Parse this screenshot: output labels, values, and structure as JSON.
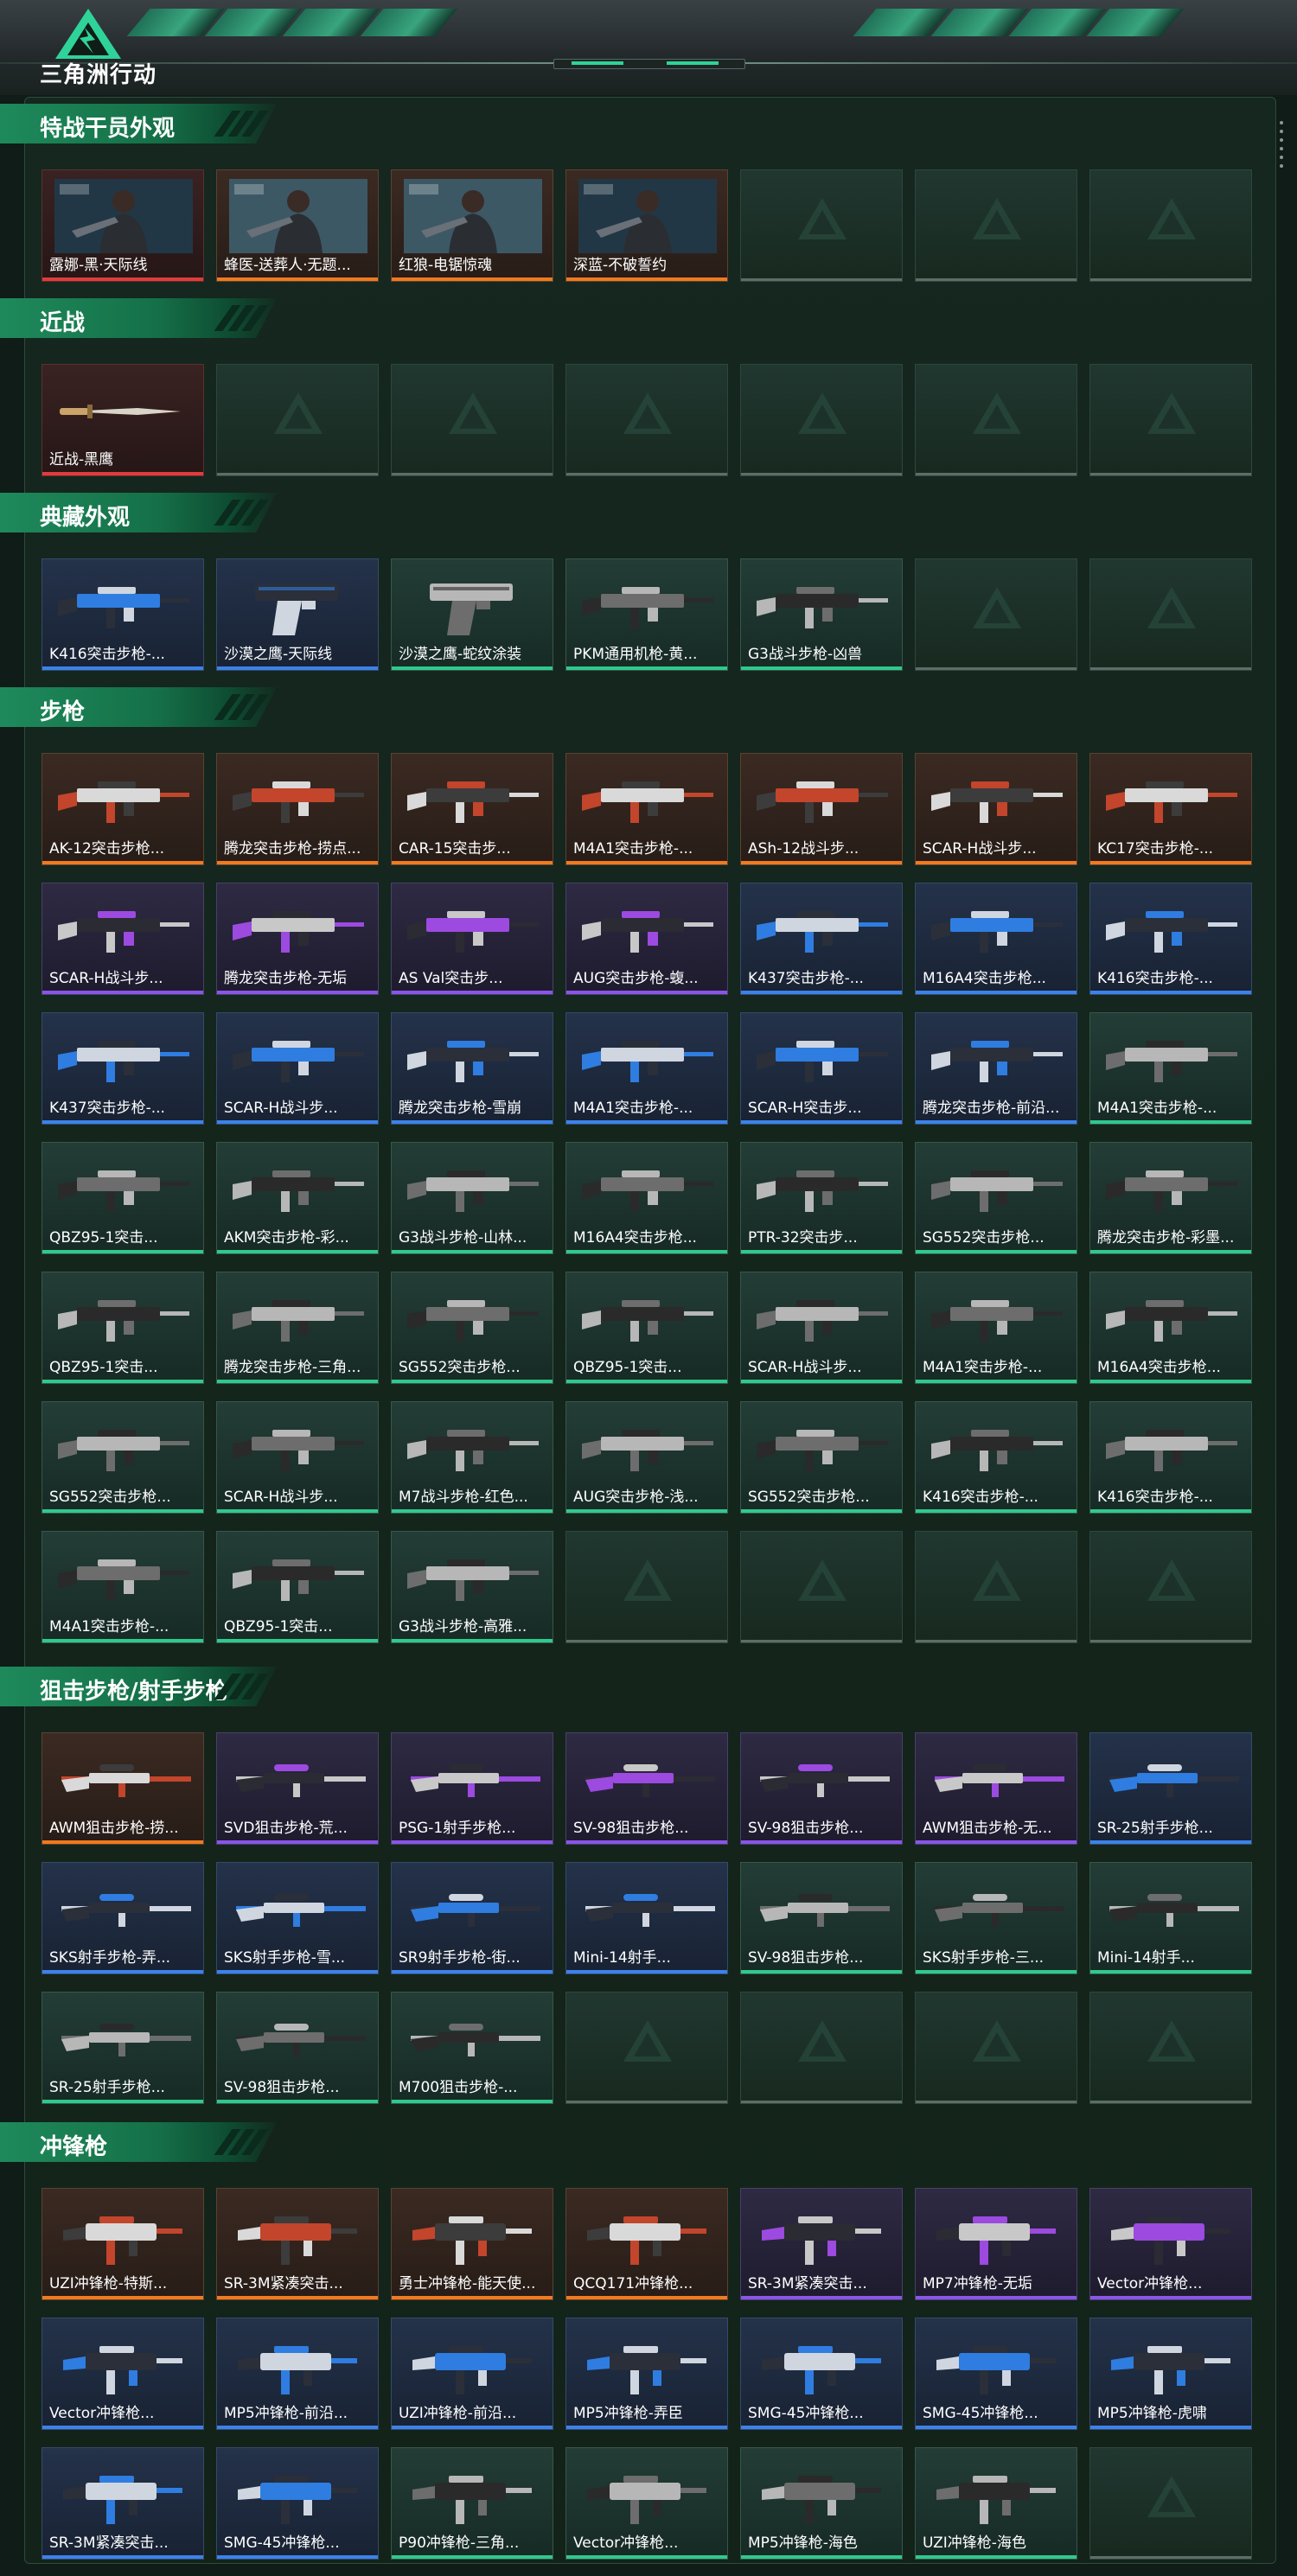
{
  "app": {
    "title": "三角洲行动"
  },
  "colors": {
    "orange": "#f07a1e",
    "purple": "#8a55e8",
    "blue": "#3c82ea",
    "green": "#2fc98e",
    "red": "#e23b3b",
    "accent": "#2fd39a"
  },
  "sections": [
    {
      "title": "特战干员外观",
      "items": [
        {
          "label": "露娜-黑·天际线",
          "rarity": "red",
          "icon": "operator-portrait"
        },
        {
          "label": "蜂医-送葬人·无题...",
          "rarity": "orange",
          "icon": "operator-portrait"
        },
        {
          "label": "红狼-电锯惊魂",
          "rarity": "orange",
          "icon": "operator-portrait"
        },
        {
          "label": "深蓝-不破誓约",
          "rarity": "orange",
          "icon": "operator-portrait"
        },
        {
          "label": "",
          "rarity": "empty"
        },
        {
          "label": "",
          "rarity": "empty"
        },
        {
          "label": "",
          "rarity": "empty"
        }
      ]
    },
    {
      "title": "近战",
      "items": [
        {
          "label": "近战-黑鹰",
          "rarity": "red",
          "icon": "knife"
        },
        {
          "label": "",
          "rarity": "empty"
        },
        {
          "label": "",
          "rarity": "empty"
        },
        {
          "label": "",
          "rarity": "empty"
        },
        {
          "label": "",
          "rarity": "empty"
        },
        {
          "label": "",
          "rarity": "empty"
        },
        {
          "label": "",
          "rarity": "empty"
        }
      ]
    },
    {
      "title": "典藏外观",
      "items": [
        {
          "label": "K416突击步枪-...",
          "rarity": "blue",
          "icon": "rifle"
        },
        {
          "label": "沙漠之鹰-天际线",
          "rarity": "blue",
          "icon": "pistol"
        },
        {
          "label": "沙漠之鹰-蛇纹涂装",
          "rarity": "green",
          "icon": "pistol"
        },
        {
          "label": "PKM通用机枪-黄...",
          "rarity": "green",
          "icon": "rifle"
        },
        {
          "label": "G3战斗步枪-凶兽",
          "rarity": "green",
          "icon": "rifle"
        },
        {
          "label": "",
          "rarity": "empty"
        },
        {
          "label": "",
          "rarity": "empty"
        }
      ]
    },
    {
      "title": "步枪",
      "items": [
        {
          "label": "AK-12突击步枪...",
          "rarity": "orange",
          "icon": "rifle"
        },
        {
          "label": "腾龙突击步枪-捞点...",
          "rarity": "orange",
          "icon": "rifle"
        },
        {
          "label": "CAR-15突击步...",
          "rarity": "orange",
          "icon": "rifle"
        },
        {
          "label": "M4A1突击步枪-...",
          "rarity": "orange",
          "icon": "rifle"
        },
        {
          "label": "ASh-12战斗步...",
          "rarity": "orange",
          "icon": "rifle"
        },
        {
          "label": "SCAR-H战斗步...",
          "rarity": "orange",
          "icon": "rifle"
        },
        {
          "label": "KC17突击步枪-...",
          "rarity": "orange",
          "icon": "rifle"
        },
        {
          "label": "SCAR-H战斗步...",
          "rarity": "purple",
          "icon": "rifle"
        },
        {
          "label": "腾龙突击步枪-无垢",
          "rarity": "purple",
          "icon": "rifle"
        },
        {
          "label": "AS Val突击步...",
          "rarity": "purple",
          "icon": "rifle"
        },
        {
          "label": "AUG突击步枪-蝮...",
          "rarity": "purple",
          "icon": "rifle"
        },
        {
          "label": "K437突击步枪-...",
          "rarity": "blue",
          "icon": "rifle"
        },
        {
          "label": "M16A4突击步枪...",
          "rarity": "blue",
          "icon": "rifle"
        },
        {
          "label": "K416突击步枪-...",
          "rarity": "blue",
          "icon": "rifle"
        },
        {
          "label": "K437突击步枪-...",
          "rarity": "blue",
          "icon": "rifle"
        },
        {
          "label": "SCAR-H战斗步...",
          "rarity": "blue",
          "icon": "rifle"
        },
        {
          "label": "腾龙突击步枪-雪崩",
          "rarity": "blue",
          "icon": "rifle"
        },
        {
          "label": "M4A1突击步枪-...",
          "rarity": "blue",
          "icon": "rifle"
        },
        {
          "label": "SCAR-H突击步...",
          "rarity": "blue",
          "icon": "rifle"
        },
        {
          "label": "腾龙突击步枪-前沿...",
          "rarity": "blue",
          "icon": "rifle"
        },
        {
          "label": "M4A1突击步枪-...",
          "rarity": "green",
          "icon": "rifle"
        },
        {
          "label": "QBZ95-1突击...",
          "rarity": "green",
          "icon": "rifle"
        },
        {
          "label": "AKM突击步枪-彩...",
          "rarity": "green",
          "icon": "rifle"
        },
        {
          "label": "G3战斗步枪-山林...",
          "rarity": "green",
          "icon": "rifle"
        },
        {
          "label": "M16A4突击步枪...",
          "rarity": "green",
          "icon": "rifle"
        },
        {
          "label": "PTR-32突击步...",
          "rarity": "green",
          "icon": "rifle"
        },
        {
          "label": "SG552突击步枪...",
          "rarity": "green",
          "icon": "rifle"
        },
        {
          "label": "腾龙突击步枪-彩墨...",
          "rarity": "green",
          "icon": "rifle"
        },
        {
          "label": "QBZ95-1突击...",
          "rarity": "green",
          "icon": "rifle"
        },
        {
          "label": "腾龙突击步枪-三角...",
          "rarity": "green",
          "icon": "rifle"
        },
        {
          "label": "SG552突击步枪...",
          "rarity": "green",
          "icon": "rifle"
        },
        {
          "label": "QBZ95-1突击...",
          "rarity": "green",
          "icon": "rifle"
        },
        {
          "label": "SCAR-H战斗步...",
          "rarity": "green",
          "icon": "rifle"
        },
        {
          "label": "M4A1突击步枪-...",
          "rarity": "green",
          "icon": "rifle"
        },
        {
          "label": "M16A4突击步枪...",
          "rarity": "green",
          "icon": "rifle"
        },
        {
          "label": "SG552突击步枪...",
          "rarity": "green",
          "icon": "rifle"
        },
        {
          "label": "SCAR-H战斗步...",
          "rarity": "green",
          "icon": "rifle"
        },
        {
          "label": "M7战斗步枪-红色...",
          "rarity": "green",
          "icon": "rifle"
        },
        {
          "label": "AUG突击步枪-浅...",
          "rarity": "green",
          "icon": "rifle"
        },
        {
          "label": "SG552突击步枪...",
          "rarity": "green",
          "icon": "rifle"
        },
        {
          "label": "K416突击步枪-...",
          "rarity": "green",
          "icon": "rifle"
        },
        {
          "label": "K416突击步枪-...",
          "rarity": "green",
          "icon": "rifle"
        },
        {
          "label": "M4A1突击步枪-...",
          "rarity": "green",
          "icon": "rifle"
        },
        {
          "label": "QBZ95-1突击...",
          "rarity": "green",
          "icon": "rifle"
        },
        {
          "label": "G3战斗步枪-高雅...",
          "rarity": "green",
          "icon": "rifle"
        },
        {
          "label": "",
          "rarity": "empty"
        },
        {
          "label": "",
          "rarity": "empty"
        },
        {
          "label": "",
          "rarity": "empty"
        },
        {
          "label": "",
          "rarity": "empty"
        }
      ]
    },
    {
      "title": "狙击步枪/射手步枪",
      "items": [
        {
          "label": "AWM狙击步枪-捞...",
          "rarity": "orange",
          "icon": "sniper"
        },
        {
          "label": "SVD狙击步枪-荒...",
          "rarity": "purple",
          "icon": "sniper"
        },
        {
          "label": "PSG-1射手步枪...",
          "rarity": "purple",
          "icon": "sniper"
        },
        {
          "label": "SV-98狙击步枪...",
          "rarity": "purple",
          "icon": "sniper"
        },
        {
          "label": "SV-98狙击步枪...",
          "rarity": "purple",
          "icon": "sniper"
        },
        {
          "label": "AWM狙击步枪-无...",
          "rarity": "purple",
          "icon": "sniper"
        },
        {
          "label": "SR-25射手步枪...",
          "rarity": "blue",
          "icon": "sniper"
        },
        {
          "label": "SKS射手步枪-弄...",
          "rarity": "blue",
          "icon": "sniper"
        },
        {
          "label": "SKS射手步枪-雪...",
          "rarity": "blue",
          "icon": "sniper"
        },
        {
          "label": "SR9射手步枪-街...",
          "rarity": "blue",
          "icon": "sniper"
        },
        {
          "label": "Mini-14射手...",
          "rarity": "blue",
          "icon": "sniper"
        },
        {
          "label": "SV-98狙击步枪...",
          "rarity": "green",
          "icon": "sniper"
        },
        {
          "label": "SKS射手步枪-三...",
          "rarity": "green",
          "icon": "sniper"
        },
        {
          "label": "Mini-14射手...",
          "rarity": "green",
          "icon": "sniper"
        },
        {
          "label": "SR-25射手步枪...",
          "rarity": "green",
          "icon": "sniper"
        },
        {
          "label": "SV-98狙击步枪...",
          "rarity": "green",
          "icon": "sniper"
        },
        {
          "label": "M700狙击步枪-...",
          "rarity": "green",
          "icon": "sniper"
        },
        {
          "label": "",
          "rarity": "empty"
        },
        {
          "label": "",
          "rarity": "empty"
        },
        {
          "label": "",
          "rarity": "empty"
        },
        {
          "label": "",
          "rarity": "empty"
        }
      ]
    },
    {
      "title": "冲锋枪",
      "items": [
        {
          "label": "UZI冲锋枪-特斯...",
          "rarity": "orange",
          "icon": "smg"
        },
        {
          "label": "SR-3M紧凑突击...",
          "rarity": "orange",
          "icon": "smg"
        },
        {
          "label": "勇士冲锋枪-能天使...",
          "rarity": "orange",
          "icon": "smg"
        },
        {
          "label": "QCQ171冲锋枪...",
          "rarity": "orange",
          "icon": "smg"
        },
        {
          "label": "SR-3M紧凑突击...",
          "rarity": "purple",
          "icon": "smg"
        },
        {
          "label": "MP7冲锋枪-无垢",
          "rarity": "purple",
          "icon": "smg"
        },
        {
          "label": "Vector冲锋枪...",
          "rarity": "purple",
          "icon": "smg"
        },
        {
          "label": "Vector冲锋枪...",
          "rarity": "blue",
          "icon": "smg"
        },
        {
          "label": "MP5冲锋枪-前沿...",
          "rarity": "blue",
          "icon": "smg"
        },
        {
          "label": "UZI冲锋枪-前沿...",
          "rarity": "blue",
          "icon": "smg"
        },
        {
          "label": "MP5冲锋枪-弄臣",
          "rarity": "blue",
          "icon": "smg"
        },
        {
          "label": "SMG-45冲锋枪...",
          "rarity": "blue",
          "icon": "smg"
        },
        {
          "label": "SMG-45冲锋枪...",
          "rarity": "blue",
          "icon": "smg"
        },
        {
          "label": "MP5冲锋枪-虎啸",
          "rarity": "blue",
          "icon": "smg"
        },
        {
          "label": "SR-3M紧凑突击...",
          "rarity": "blue",
          "icon": "smg"
        },
        {
          "label": "SMG-45冲锋枪...",
          "rarity": "blue",
          "icon": "smg"
        },
        {
          "label": "P90冲锋枪-三角...",
          "rarity": "green",
          "icon": "smg"
        },
        {
          "label": "Vector冲锋枪...",
          "rarity": "green",
          "icon": "smg"
        },
        {
          "label": "MP5冲锋枪-海色",
          "rarity": "green",
          "icon": "smg"
        },
        {
          "label": "UZI冲锋枪-海色",
          "rarity": "green",
          "icon": "smg"
        },
        {
          "label": "",
          "rarity": "empty"
        }
      ]
    }
  ]
}
